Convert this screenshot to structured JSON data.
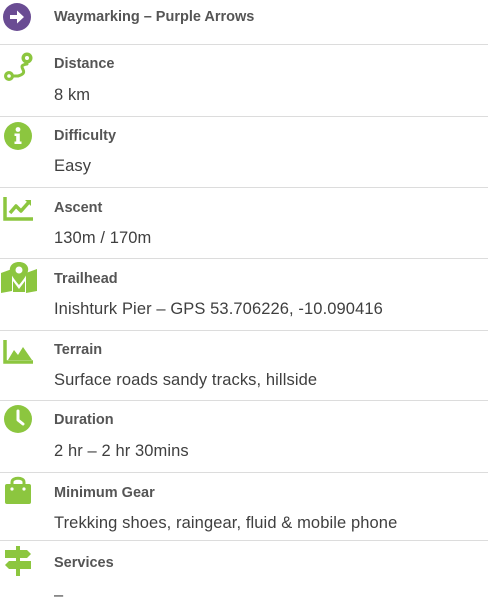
{
  "colors": {
    "purple": "#6a4c93",
    "green": "#8cc63f",
    "divider": "#dcdcdc"
  },
  "rows": [
    {
      "icon": "arrow-right-circle-icon",
      "label": "Waymarking – Purple Arrows",
      "value": ""
    },
    {
      "icon": "route-icon",
      "label": "Distance",
      "value": "8 km"
    },
    {
      "icon": "info-circle-icon",
      "label": "Difficulty",
      "value": "Easy"
    },
    {
      "icon": "trend-chart-icon",
      "label": "Ascent",
      "value": "130m / 170m"
    },
    {
      "icon": "map-pin-icon",
      "label": "Trailhead",
      "value": "Inishturk Pier – GPS 53.706226, -10.090416"
    },
    {
      "icon": "mountain-icon",
      "label": "Terrain",
      "value": "Surface roads sandy tracks, hillside"
    },
    {
      "icon": "clock-icon",
      "label": "Duration",
      "value": "2 hr – 2 hr 30mins"
    },
    {
      "icon": "bag-icon",
      "label": "Minimum Gear",
      "value": "Trekking shoes, raingear, fluid & mobile phone"
    },
    {
      "icon": "signpost-icon",
      "label": "Services",
      "value": "–"
    }
  ]
}
